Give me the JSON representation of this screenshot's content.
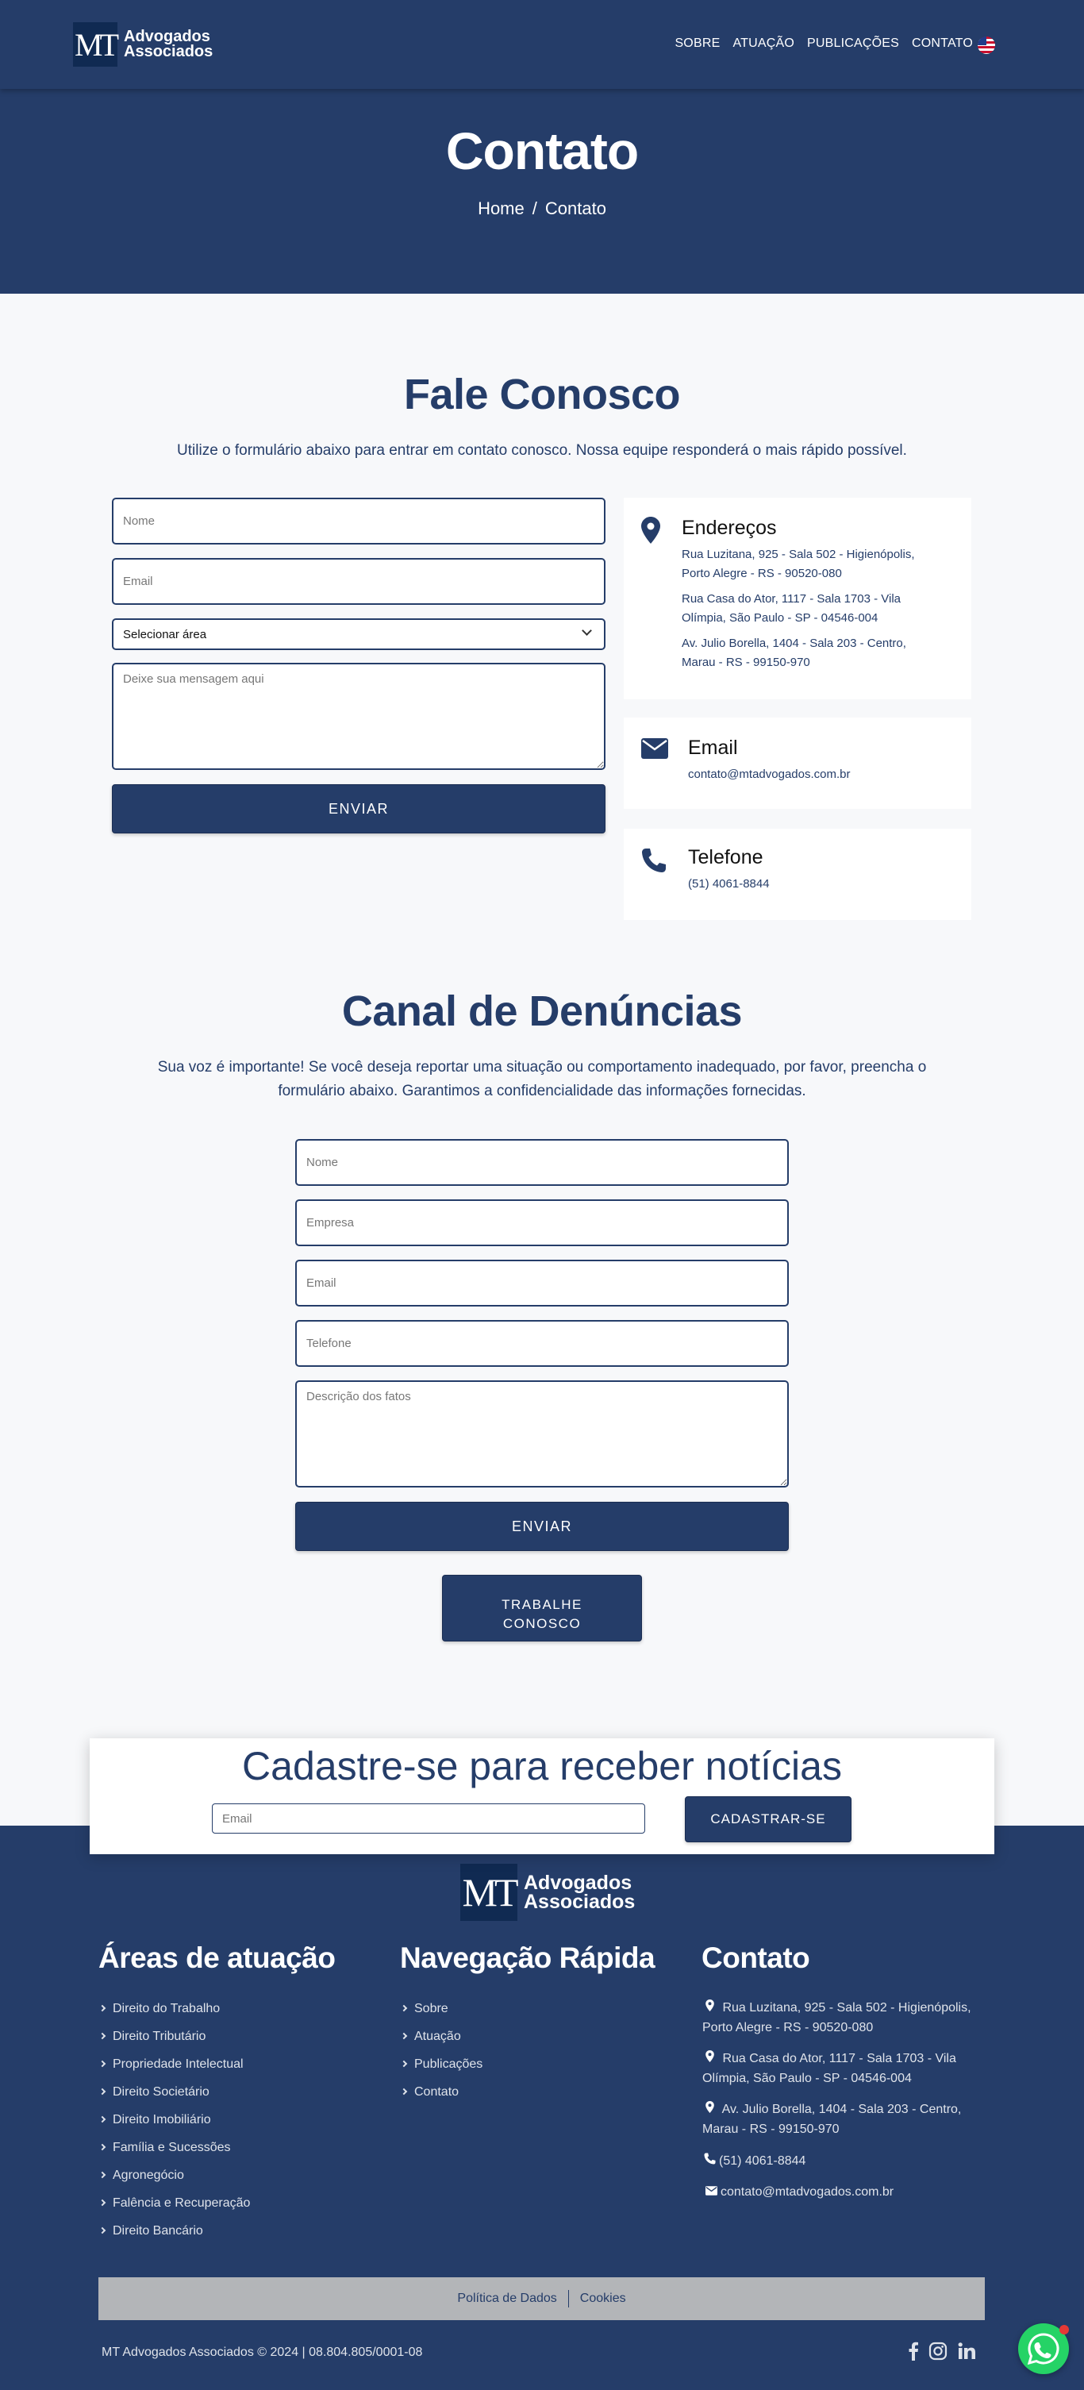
{
  "header": {
    "logo_mark": "MT",
    "logo_line1": "Advogados",
    "logo_line2": "Associados",
    "nav": [
      "SOBRE",
      "ATUAÇÃO",
      "PUBLICAÇÕES",
      "CONTATO"
    ],
    "language_icon": "us-flag-icon"
  },
  "hero": {
    "title": "Contato",
    "breadcrumb_home": "Home",
    "breadcrumb_sep": "/",
    "breadcrumb_current": "Contato"
  },
  "contact": {
    "title": "Fale Conosco",
    "subtitle": "Utilize o formulário abaixo para entrar em contato conosco. Nossa equipe responderá o mais rápido possível.",
    "form": {
      "name_placeholder": "Nome",
      "email_placeholder": "Email",
      "area_selected": "Selecionar área",
      "message_placeholder": "Deixe sua mensagem aqui",
      "submit_label": "ENVIAR"
    },
    "addresses": {
      "title": "Endereços",
      "items": [
        "Rua Luzitana, 925 - Sala 502 - Higienópolis,",
        "Porto Alegre - RS - 90520-080",
        "Rua Casa do Ator, 1117 - Sala 1703 - Vila",
        "Olímpia, São Paulo - SP - 04546-004",
        "Av. Julio Borella, 1404 - Sala 203 - Centro,",
        "Marau - RS - 99150-970"
      ]
    },
    "email": {
      "title": "Email",
      "value": "contato@mtadvogados.com.br"
    },
    "phone": {
      "title": "Telefone",
      "value": "(51) 4061-8844"
    }
  },
  "complaints": {
    "title": "Canal de Denúncias",
    "subtitle_line1": "Sua voz é importante! Se você deseja reportar uma situação ou comportamento inadequado, por favor, preencha o",
    "subtitle_line2": "formulário abaixo. Garantimos a confidencialidade das informações fornecidas.",
    "form": {
      "name_placeholder": "Nome",
      "company_placeholder": "Empresa",
      "email_placeholder": "Email",
      "phone_placeholder": "Telefone",
      "description_placeholder": "Descrição dos fatos",
      "submit_label": "ENVIAR"
    },
    "careers_line1": "TRABALHE",
    "careers_line2": "CONOSCO"
  },
  "newsletter": {
    "title": "Cadastre-se para receber notícias",
    "email_placeholder": "Email",
    "button_label": "CADASTRAR-SE"
  },
  "footer": {
    "areas_title": "Áreas de atuação",
    "areas": [
      "Direito do Trabalho",
      "Direito Tributário",
      "Propriedade Intelectual",
      "Direito Societário",
      "Direito Imobiliário",
      "Família e Sucessões",
      "Agronegócio",
      "Falência e Recuperação",
      "Direito Bancário"
    ],
    "nav_title": "Navegação Rápida",
    "nav": [
      "Sobre",
      "Atuação",
      "Publicações",
      "Contato"
    ],
    "contact_title": "Contato",
    "contact_addresses": [
      [
        "Rua Luzitana, 925 - Sala 502 - Higienópolis,",
        "Porto Alegre - RS - 90520-080"
      ],
      [
        "Rua Casa do Ator, 1117 - Sala 1703 - Vila",
        "Olímpia, São Paulo - SP - 04546-004"
      ],
      [
        "Av. Julio Borella, 1404 - Sala 203 - Centro,",
        "Marau - RS - 99150-970"
      ]
    ],
    "contact_phone": "(51) 4061-8844",
    "contact_email": "contato@mtadvogados.com.br",
    "legal_privacy": "Política de Dados",
    "legal_cookies": "Cookies",
    "copyright": "MT Advogados Associados © 2024 | 08.804.805/0001-08",
    "social_icons": [
      "facebook-icon",
      "instagram-icon",
      "linkedin-icon"
    ]
  },
  "colors": {
    "primary": "#253d69",
    "background": "#f7f8fa",
    "legal_bar": "#b3b5b8",
    "whatsapp": "#25d366"
  }
}
